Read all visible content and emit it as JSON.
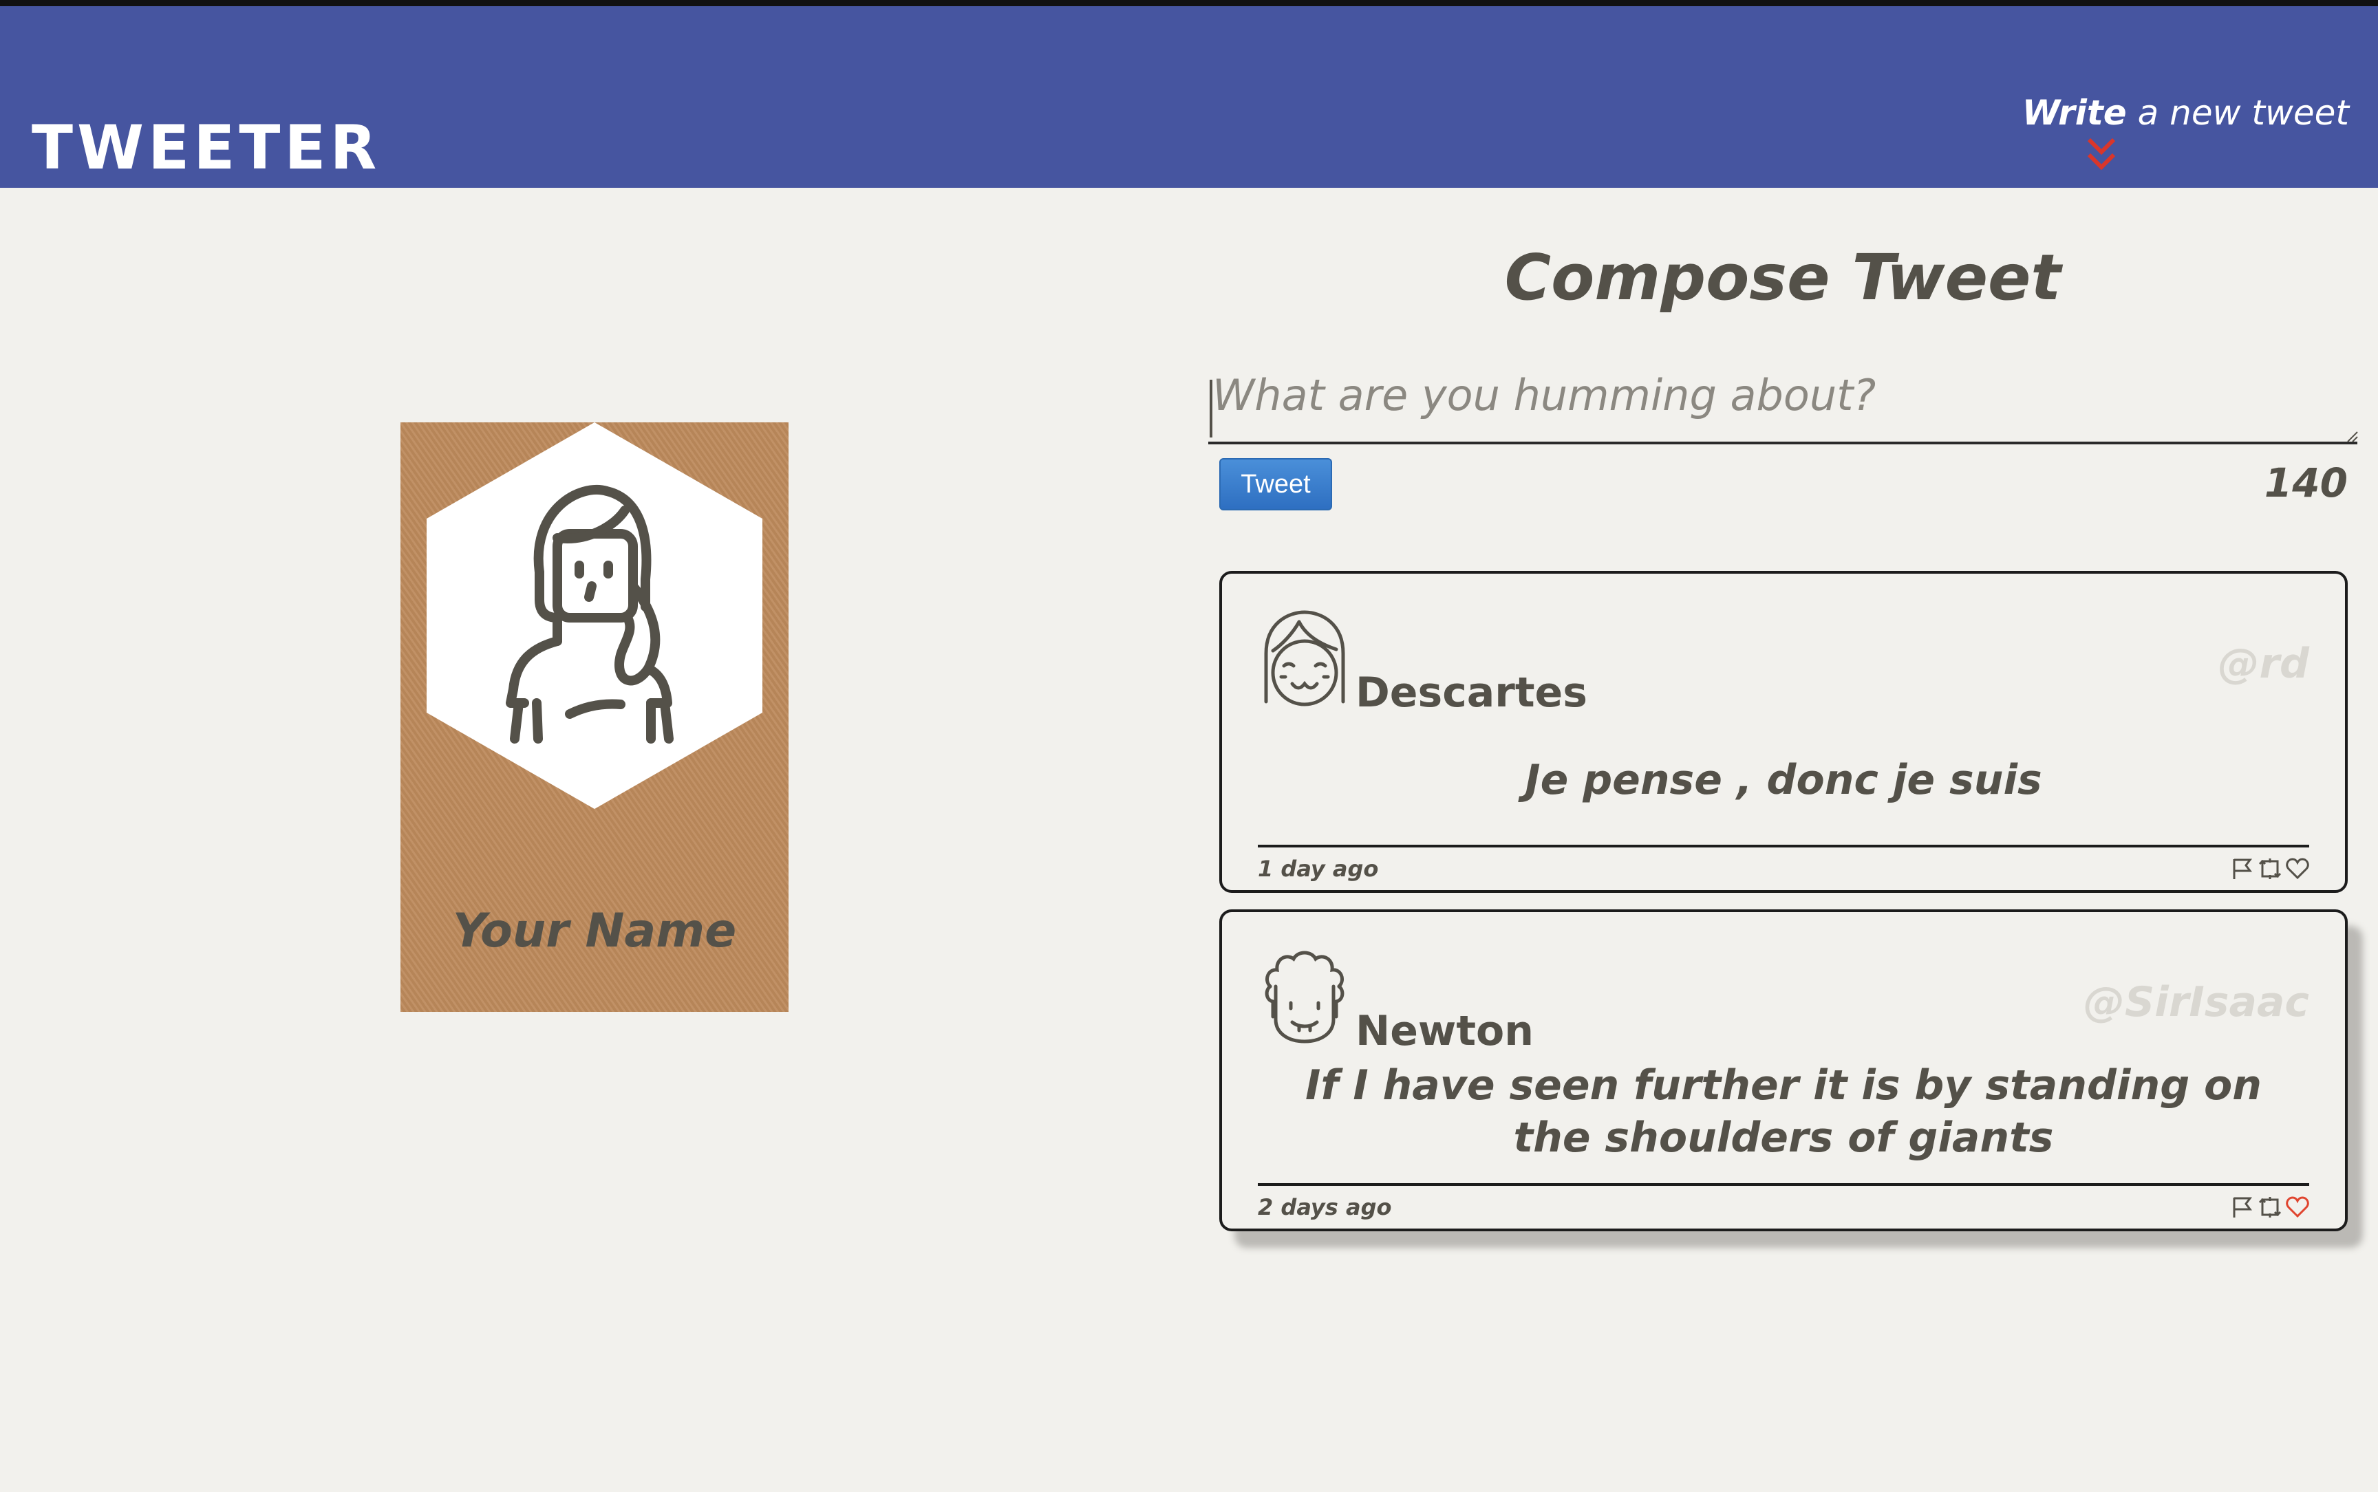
{
  "header": {
    "brand": "TWEETER",
    "write_bold": "Write",
    "write_rest": " a new tweet",
    "chevron_icon": "double-chevron-down-icon",
    "chevron_color": "#d9362b",
    "background_color": "#4655a0"
  },
  "profile": {
    "name": "Your Name",
    "card_color": "#bd8a5c",
    "avatar_icon": "woman-avatar-icon"
  },
  "compose": {
    "title": "Compose Tweet",
    "placeholder": "What are you humming about?",
    "button_label": "Tweet",
    "counter": "140",
    "button_color": "#3a7ccd"
  },
  "tweets": [
    {
      "name": "Descartes",
      "handle": "@rd",
      "content": "Je pense , donc je suis",
      "time": "1 day ago",
      "avatar_icon": "smiling-face-avatar-icon",
      "liked": false
    },
    {
      "name": "Newton",
      "handle": "@SirIsaac",
      "content": "If I have seen further it is by standing on the shoulders of giants",
      "time": "2 days ago",
      "avatar_icon": "curly-hair-avatar-icon",
      "liked": true
    }
  ],
  "colors": {
    "page_background": "#f2f1ed",
    "text": "#545149",
    "handle": "#d9d7d1",
    "liked_heart": "#e0452f"
  }
}
